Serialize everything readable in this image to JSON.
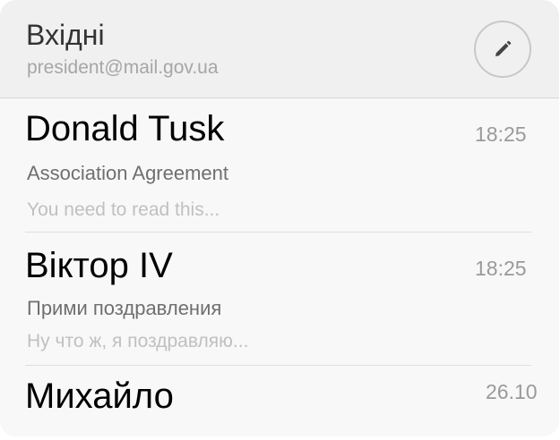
{
  "header": {
    "title": "Вхідні",
    "account": "president@mail.gov.ua",
    "compose_icon": "pencil-icon"
  },
  "messages": [
    {
      "sender": "Donald Tusk",
      "time": "18:25",
      "subject": "Association Agreement",
      "preview": "You need to read this..."
    },
    {
      "sender": "Віктор IV",
      "time": "18:25",
      "subject": "Прими поздравления",
      "preview": "Ну что ж, я поздравляю..."
    },
    {
      "sender": "Михайло",
      "time": "26.10"
    }
  ]
}
